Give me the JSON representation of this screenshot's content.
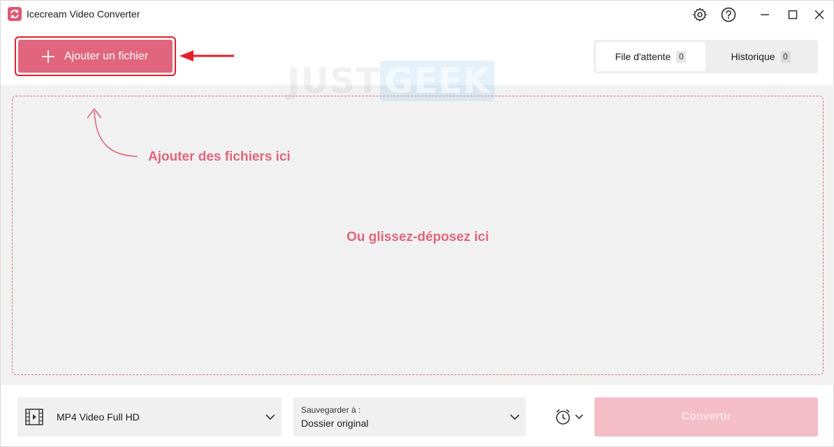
{
  "window": {
    "title": "Icecream Video Converter",
    "logo_icon": "converter-logo-icon",
    "controls": [
      "settings-icon",
      "help-icon",
      "minimize-icon",
      "maximize-icon",
      "close-icon"
    ]
  },
  "toolbar": {
    "add_file_label": "Ajouter un fichier",
    "add_icon": "plus-icon",
    "highlight_color": "#e3202a"
  },
  "tabs": [
    {
      "label": "File d'attente",
      "count": "0",
      "active": true
    },
    {
      "label": "Historique",
      "count": "0",
      "active": false
    }
  ],
  "watermark": {
    "part1": "JUST",
    "part2": "GEEK"
  },
  "drop_zone": {
    "hint_add": "Ajouter des fichiers ici",
    "hint_drop": "Ou glissez-déposez ici"
  },
  "bottom": {
    "format_label": "MP4 Video Full HD",
    "format_icon": "film-icon",
    "save_caption": "Sauvegarder à :",
    "save_value": "Dossier original",
    "timer_icon": "alarm-clock-icon",
    "convert_label": "Convertir"
  },
  "colors": {
    "accent": "#e0657d",
    "accent_disabled": "#f4bdc8",
    "panel_bg": "#f1f1f1"
  }
}
